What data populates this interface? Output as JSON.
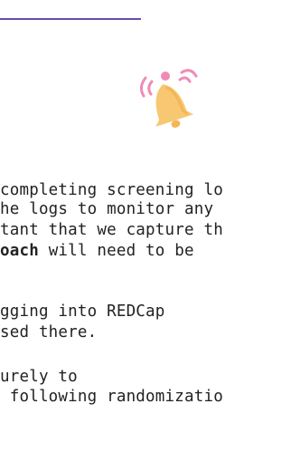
{
  "header": {
    "accent_color": "#6b4aa6"
  },
  "alert": {
    "icon": "bell-icon",
    "icon_color": "#f7c771",
    "wave_color": "#f08bb8"
  },
  "body": {
    "paragraph1": {
      "line1": "completing screening lo",
      "line2": "he logs to monitor any",
      "line3": "tant that we capture th",
      "line4_bold": "oach",
      "line4_rest": " will need to be"
    },
    "paragraph2": {
      "line1": "gging into REDCap",
      "line2": "sed there."
    },
    "paragraph3": {
      "line1": "urely to",
      "line2": " following randomizatio"
    }
  }
}
